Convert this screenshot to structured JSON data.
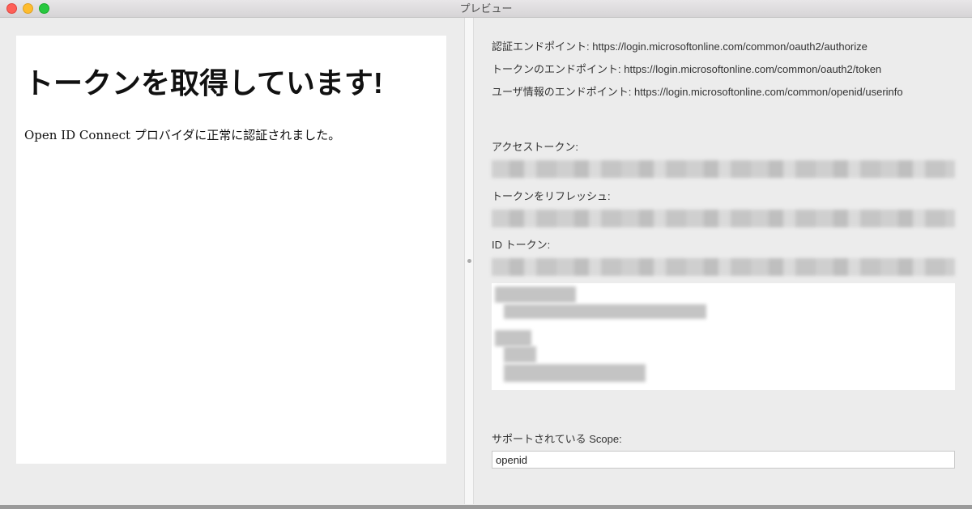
{
  "window": {
    "title": "プレビュー"
  },
  "left": {
    "heading": "トークンを取得しています!",
    "message": "Open ID Connect プロバイダに正常に認証されました。"
  },
  "right": {
    "endpoints": [
      "認証エンドポイント: https://login.microsoftonline.com/common/oauth2/authorize",
      "トークンのエンドポイント: https://login.microsoftonline.com/common/oauth2/token",
      "ユーザ情報のエンドポイント: https://login.microsoftonline.com/common/openid/userinfo"
    ],
    "access_token_label": "アクセストークン:",
    "refresh_token_label": "トークンをリフレッシュ:",
    "id_token_label": "ID トークン:",
    "scope_label": "サポートされている Scope:",
    "scope_value": "openid"
  }
}
